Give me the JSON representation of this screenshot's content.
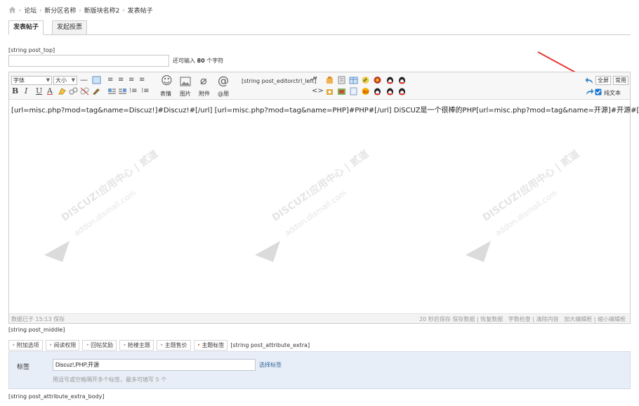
{
  "breadcrumb": {
    "items": [
      "论坛",
      "新分区名称",
      "新版块名称2",
      "发表帖子"
    ]
  },
  "tabs": [
    "发表帖子",
    "发起投票"
  ],
  "post_top": "[string post_top]",
  "subject": {
    "value": "",
    "count_prefix": "还可输入",
    "count": "80",
    "count_suffix": "个字符"
  },
  "toolbar": {
    "font": "字体",
    "size": "大小",
    "bold": "B",
    "italic": "I",
    "underline": "U",
    "color": "A",
    "smiley_label": "表情",
    "image_label": "图片",
    "attach_label": "附件",
    "at_label": "@朋",
    "editorctrl_left": "[string post_editorctrl_left]",
    "fullscreen": "全屏",
    "common": "常用",
    "plaintext": "纯文本"
  },
  "editor": {
    "content": "[url=misc.php?mod=tag&name=Discuz!]#Discuz!#[/url] [url=misc.php?mod=tag&name=PHP]#PHP#[/url] DiSCUZ是一个很棒的PHP[url=misc.php?mod=tag&name=开源]#开源#[/url]程序",
    "saved_status": "数据已于 15:13 保存",
    "autosave": "20 秒后保存",
    "save_data": "保存数据",
    "restore_data": "恢复数据",
    "char_check": "字数检查",
    "clear": "清除内容",
    "enlarge": "加大编辑框",
    "shrink": "缩小编辑框",
    "plaintext_checked": true
  },
  "watermark": {
    "line1": "DISCUZ!应用中心 | 贰道",
    "line2": "addon.dismall.com"
  },
  "post_middle": "[string post_middle]",
  "attr_tabs": [
    "附加选项",
    "阅读权限",
    "回帖奖励",
    "抢楼主题",
    "主题售价",
    "主题标签"
  ],
  "attr_active": "主题标签",
  "attribute_extra": "[string post_attribute_extra]",
  "tag": {
    "label": "标签",
    "value": "Discuz!,PHP,开源",
    "select_link": "选择标签",
    "hint": "用逗号或空格隔开多个标签，最多可填写 5 个"
  },
  "attribute_extra_body": "[string post_attribute_extra_body]",
  "colors": {
    "accent": "#f26c4f",
    "link": "#336699",
    "panel": "#e8eef7",
    "arrow": "#e53935",
    "checkbox": "#1976d2"
  }
}
